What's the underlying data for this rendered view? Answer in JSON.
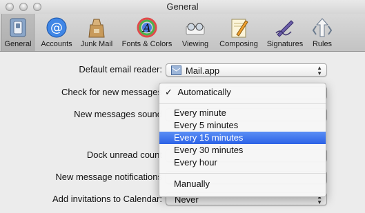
{
  "window": {
    "title": "General"
  },
  "toolbar": {
    "items": [
      {
        "label": "General",
        "icon": "switch-icon",
        "selected": true
      },
      {
        "label": "Accounts",
        "icon": "at-icon"
      },
      {
        "label": "Junk Mail",
        "icon": "junk-bag-icon"
      },
      {
        "label": "Fonts & Colors",
        "icon": "fonts-colors-icon"
      },
      {
        "label": "Viewing",
        "icon": "glasses-icon"
      },
      {
        "label": "Composing",
        "icon": "pencil-paper-icon"
      },
      {
        "label": "Signatures",
        "icon": "signature-pen-icon"
      },
      {
        "label": "Rules",
        "icon": "rules-arrows-icon"
      }
    ]
  },
  "settings": {
    "default_reader_label": "Default email reader:",
    "default_reader_value": "Mail.app",
    "check_label": "Check for new messages",
    "new_sound_label": "New messages sound",
    "dock_label": "Dock unread count",
    "notif_label": "New message notifications",
    "invitations_label": "Add invitations to Calendar:",
    "invitations_value": "Never"
  },
  "menu": {
    "check_mark": "✓",
    "items": [
      "Automatically",
      "Every minute",
      "Every 5 minutes",
      "Every 15 minutes",
      "Every 30 minutes",
      "Every hour",
      "Manually"
    ],
    "selected": "Automatically",
    "highlighted": "Every 15 minutes",
    "highlight_color": "#3a6ff0"
  },
  "partial_text": "s"
}
